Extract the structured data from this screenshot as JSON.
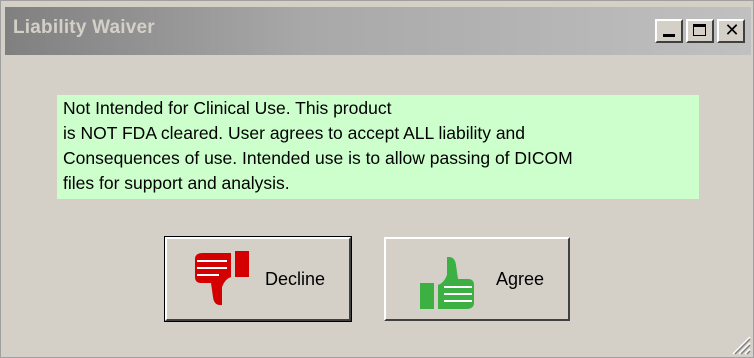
{
  "window": {
    "title": "Liability Waiver",
    "controls": {
      "minimize": "minimize",
      "maximize": "maximize",
      "close": "close"
    }
  },
  "notice": {
    "lines": [
      "Not Intended for Clinical Use.  This product",
      "is NOT FDA cleared.  User agrees to accept ALL liability and",
      "Consequences of use.  Intended use is to allow passing of DICOM",
      "files for support and analysis."
    ],
    "background": "#ccffcc"
  },
  "buttons": {
    "decline": {
      "label": "Decline",
      "icon": "thumbs-down-icon",
      "color": "#d40000"
    },
    "agree": {
      "label": "Agree",
      "icon": "thumbs-up-icon",
      "color": "#3cb043"
    }
  }
}
